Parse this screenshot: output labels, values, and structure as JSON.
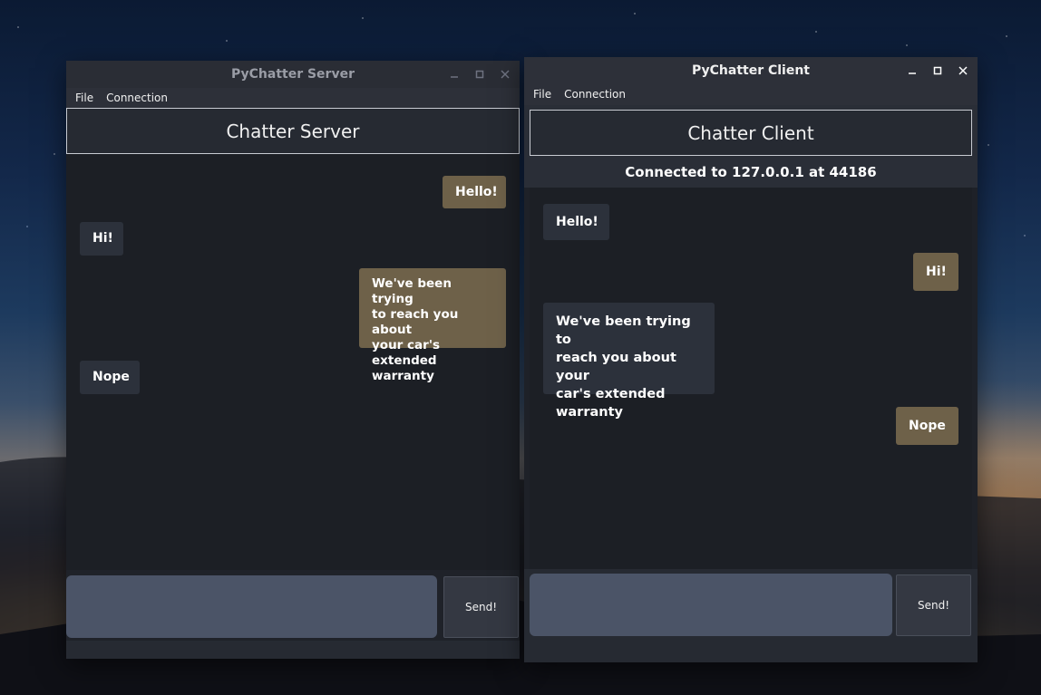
{
  "server": {
    "window_title": "PyChatter Server",
    "menu": [
      "File",
      "Connection"
    ],
    "header": "Chatter Server",
    "messages": [
      {
        "text": "Hello!",
        "direction": "outgoing"
      },
      {
        "text": "Hi!",
        "direction": "incoming"
      },
      {
        "text": "We've been trying\nto reach you about\nyour car's\nextended warranty",
        "direction": "outgoing"
      },
      {
        "text": "Nope",
        "direction": "incoming"
      }
    ],
    "input_value": "",
    "send_label": "Send!"
  },
  "client": {
    "window_title": "PyChatter Client",
    "menu": [
      "File",
      "Connection"
    ],
    "header": "Chatter Client",
    "status": "Connected to 127.0.0.1 at 44186",
    "messages": [
      {
        "text": "Hello!",
        "direction": "incoming"
      },
      {
        "text": "Hi!",
        "direction": "outgoing"
      },
      {
        "text": "We've been trying to\nreach you about your\ncar's extended\nwarranty",
        "direction": "incoming"
      },
      {
        "text": "Nope",
        "direction": "outgoing"
      }
    ],
    "input_value": "",
    "send_label": "Send!"
  },
  "colors": {
    "outgoing_bubble": "#6e6149",
    "incoming_bubble": "#2c313b",
    "input_field": "#4b5467",
    "window_bg": "#1e2128"
  },
  "icons": {
    "minimize": "minimize-icon",
    "maximize": "maximize-icon",
    "close": "close-icon"
  }
}
